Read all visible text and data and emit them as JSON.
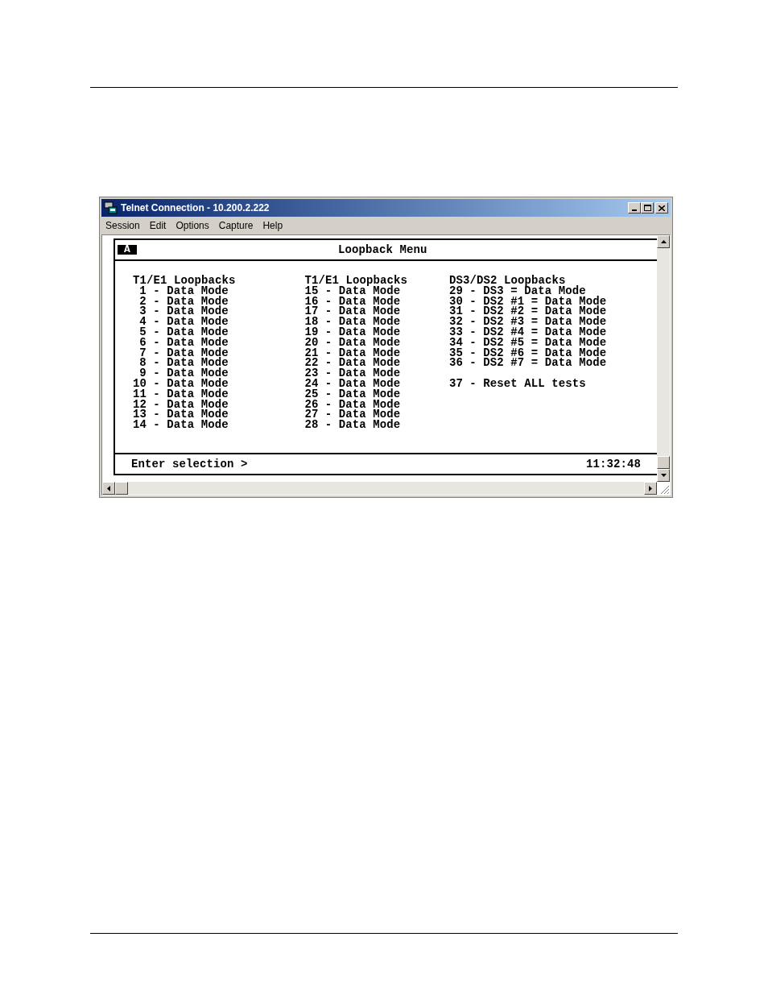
{
  "window": {
    "title": "Telnet Connection - 10.200.2.222"
  },
  "menu": [
    "Session",
    "Edit",
    "Options",
    "Capture",
    "Help"
  ],
  "terminal": {
    "session_badge": "A",
    "title": "Loopback Menu",
    "columns": [
      {
        "heading": "T1/E1 Loopbacks",
        "options": [
          {
            "number": "1",
            "label": "- Data Mode"
          },
          {
            "number": "2",
            "label": "- Data Mode"
          },
          {
            "number": "3",
            "label": "- Data Mode"
          },
          {
            "number": "4",
            "label": "- Data Mode"
          },
          {
            "number": "5",
            "label": "- Data Mode"
          },
          {
            "number": "6",
            "label": "- Data Mode"
          },
          {
            "number": "7",
            "label": "- Data Mode"
          },
          {
            "number": "8",
            "label": "- Data Mode"
          },
          {
            "number": "9",
            "label": "- Data Mode"
          },
          {
            "number": "10",
            "label": "- Data Mode"
          },
          {
            "number": "11",
            "label": "- Data Mode"
          },
          {
            "number": "12",
            "label": "- Data Mode"
          },
          {
            "number": "13",
            "label": "- Data Mode"
          },
          {
            "number": "14",
            "label": "- Data Mode"
          }
        ]
      },
      {
        "heading": "T1/E1 Loopbacks",
        "options": [
          {
            "number": "15",
            "label": "- Data Mode"
          },
          {
            "number": "16",
            "label": "- Data Mode"
          },
          {
            "number": "17",
            "label": "- Data Mode"
          },
          {
            "number": "18",
            "label": "- Data Mode"
          },
          {
            "number": "19",
            "label": "- Data Mode"
          },
          {
            "number": "20",
            "label": "- Data Mode"
          },
          {
            "number": "21",
            "label": "- Data Mode"
          },
          {
            "number": "22",
            "label": "- Data Mode"
          },
          {
            "number": "23",
            "label": "- Data Mode"
          },
          {
            "number": "24",
            "label": "- Data Mode"
          },
          {
            "number": "25",
            "label": "- Data Mode"
          },
          {
            "number": "26",
            "label": "- Data Mode"
          },
          {
            "number": "27",
            "label": "- Data Mode"
          },
          {
            "number": "28",
            "label": "- Data Mode"
          }
        ]
      },
      {
        "heading": "DS3/DS2 Loopbacks",
        "options": [
          {
            "number": "29",
            "label": "- DS3 = Data Mode"
          },
          {
            "number": "30",
            "label": "- DS2 #1 = Data Mode"
          },
          {
            "number": "31",
            "label": "- DS2 #2 = Data Mode"
          },
          {
            "number": "32",
            "label": "- DS2 #3 = Data Mode"
          },
          {
            "number": "33",
            "label": "- DS2 #4 = Data Mode"
          },
          {
            "number": "34",
            "label": "- DS2 #5 = Data Mode"
          },
          {
            "number": "35",
            "label": "- DS2 #6 = Data Mode"
          },
          {
            "number": "36",
            "label": "- DS2 #7 = Data Mode"
          }
        ],
        "extra": {
          "number": "37",
          "label": "- Reset ALL tests"
        }
      }
    ],
    "prompt": "Enter selection >",
    "time": "11:32:48"
  }
}
